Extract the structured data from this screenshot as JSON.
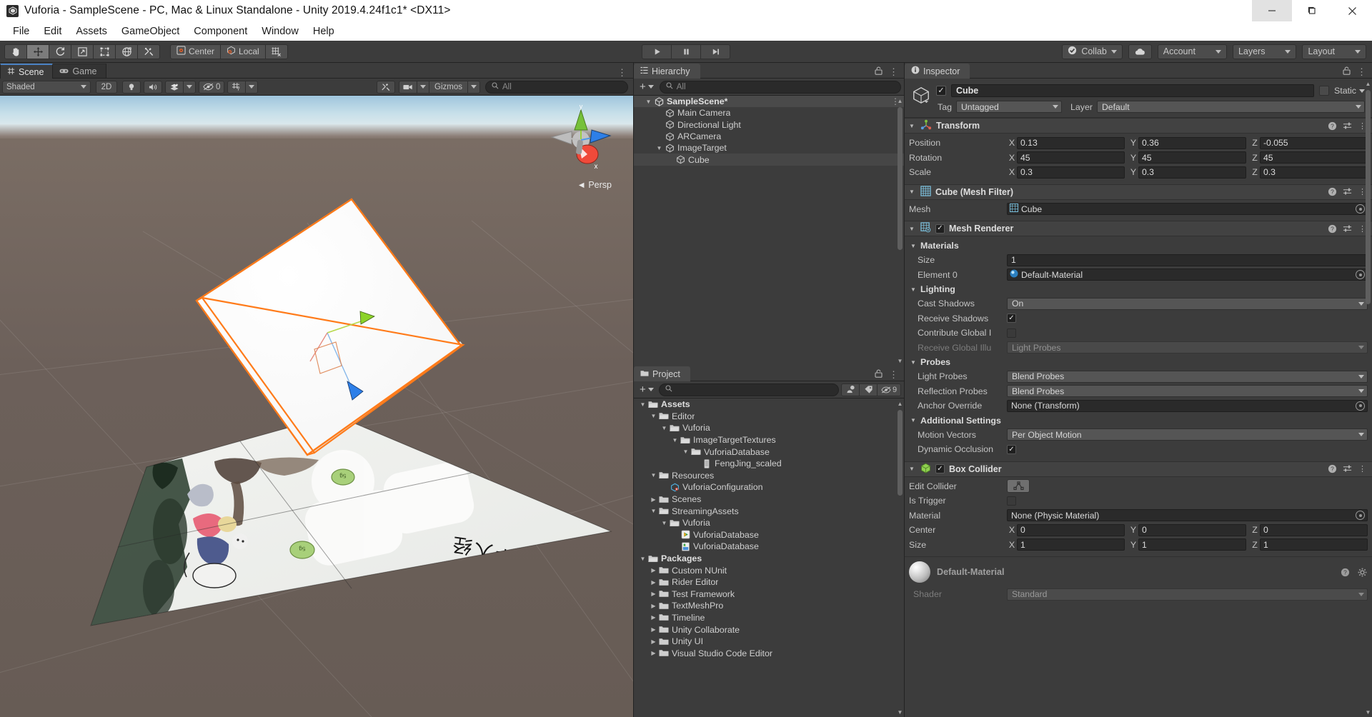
{
  "window": {
    "title": "Vuforia - SampleScene - PC, Mac & Linux Standalone - Unity 2019.4.24f1c1* <DX11>",
    "minimize": "minimize-button",
    "maximize": "maximize-button",
    "close": "close-button"
  },
  "menubar": {
    "items": [
      "File",
      "Edit",
      "Assets",
      "GameObject",
      "Component",
      "Window",
      "Help"
    ]
  },
  "toolbar": {
    "tools": [
      {
        "name": "hand-tool",
        "icon": "hand",
        "active": false
      },
      {
        "name": "move-tool",
        "icon": "move",
        "active": true
      },
      {
        "name": "rotate-tool",
        "icon": "rotate",
        "active": false
      },
      {
        "name": "scale-tool",
        "icon": "scale",
        "active": false
      },
      {
        "name": "rect-tool",
        "icon": "rect",
        "active": false
      },
      {
        "name": "transform-tool",
        "icon": "transform",
        "active": false
      },
      {
        "name": "custom-editor-tool",
        "icon": "wrench",
        "active": false
      }
    ],
    "pivot_label": "Center",
    "space_label": "Local",
    "snap_label": "grid-snap",
    "play": "play-button",
    "pause": "pause-button",
    "step": "step-button",
    "collab_label": "Collab",
    "cloud_label": "cloud-button",
    "account_label": "Account",
    "layers_label": "Layers",
    "layout_label": "Layout"
  },
  "scene_panel": {
    "tabs": [
      {
        "label": "Scene",
        "active": true
      },
      {
        "label": "Game",
        "active": false
      }
    ],
    "shading_mode": "Shaded",
    "two_d_label": "2D",
    "lighting_toggle": "lighting-icon",
    "audio_toggle": "audio-icon",
    "fx_toggle": "fx-icon",
    "hidden_count": "0",
    "grid_label": "grid-icon",
    "tool_settings": "scene-tools-icon",
    "camera_label": "camera-icon",
    "gizmos_label": "Gizmos",
    "search_placeholder": "All",
    "gizmo": {
      "axis_y": "y",
      "axis_x": "x",
      "mode_label": "Persp"
    }
  },
  "hierarchy": {
    "tab_label": "Hierarchy",
    "create_label": "+",
    "search_placeholder": "All",
    "items": [
      {
        "label": "SampleScene*",
        "depth": 0,
        "twist": "down",
        "icon": "scene-icon",
        "bold": true,
        "selected": true,
        "dots": true
      },
      {
        "label": "Main Camera",
        "depth": 1,
        "twist": "",
        "icon": "gameobject-icon",
        "bold": false,
        "selected": false,
        "dots": false
      },
      {
        "label": "Directional Light",
        "depth": 1,
        "twist": "",
        "icon": "gameobject-icon",
        "bold": false,
        "selected": false,
        "dots": false
      },
      {
        "label": "ARCamera",
        "depth": 1,
        "twist": "",
        "icon": "gameobject-icon",
        "bold": false,
        "selected": false,
        "dots": false
      },
      {
        "label": "ImageTarget",
        "depth": 1,
        "twist": "down",
        "icon": "gameobject-icon",
        "bold": false,
        "selected": false,
        "dots": false
      },
      {
        "label": "Cube",
        "depth": 2,
        "twist": "",
        "icon": "gameobject-icon",
        "bold": false,
        "selected": true,
        "dots": false
      }
    ]
  },
  "project": {
    "tab_label": "Project",
    "create_label": "+",
    "search_placeholder": "",
    "visibility_count": "9",
    "items": [
      {
        "label": "Assets",
        "depth": 0,
        "twist": "down",
        "icon": "folder-open",
        "bold": true
      },
      {
        "label": "Editor",
        "depth": 1,
        "twist": "down",
        "icon": "folder-open",
        "bold": false
      },
      {
        "label": "Vuforia",
        "depth": 2,
        "twist": "down",
        "icon": "folder-open",
        "bold": false
      },
      {
        "label": "ImageTargetTextures",
        "depth": 3,
        "twist": "down",
        "icon": "folder-open",
        "bold": false
      },
      {
        "label": "VuforiaDatabase",
        "depth": 4,
        "twist": "down",
        "icon": "folder-open",
        "bold": false
      },
      {
        "label": "FengJing_scaled",
        "depth": 5,
        "twist": "",
        "icon": "texture-icon",
        "bold": false
      },
      {
        "label": "Resources",
        "depth": 1,
        "twist": "down",
        "icon": "folder-open",
        "bold": false
      },
      {
        "label": "VuforiaConfiguration",
        "depth": 2,
        "twist": "",
        "icon": "config-icon",
        "bold": false
      },
      {
        "label": "Scenes",
        "depth": 1,
        "twist": "right",
        "icon": "folder-closed",
        "bold": false
      },
      {
        "label": "StreamingAssets",
        "depth": 1,
        "twist": "down",
        "icon": "folder-open",
        "bold": false
      },
      {
        "label": "Vuforia",
        "depth": 2,
        "twist": "down",
        "icon": "folder-open",
        "bold": false
      },
      {
        "label": "VuforiaDatabase",
        "depth": 3,
        "twist": "",
        "icon": "dat-icon",
        "bold": false
      },
      {
        "label": "VuforiaDatabase",
        "depth": 3,
        "twist": "",
        "icon": "xml-icon",
        "bold": false
      },
      {
        "label": "Packages",
        "depth": 0,
        "twist": "down",
        "icon": "folder-open",
        "bold": true
      },
      {
        "label": "Custom NUnit",
        "depth": 1,
        "twist": "right",
        "icon": "folder-closed",
        "bold": false
      },
      {
        "label": "Rider Editor",
        "depth": 1,
        "twist": "right",
        "icon": "folder-closed",
        "bold": false
      },
      {
        "label": "Test Framework",
        "depth": 1,
        "twist": "right",
        "icon": "folder-closed",
        "bold": false
      },
      {
        "label": "TextMeshPro",
        "depth": 1,
        "twist": "right",
        "icon": "folder-closed",
        "bold": false
      },
      {
        "label": "Timeline",
        "depth": 1,
        "twist": "right",
        "icon": "folder-closed",
        "bold": false
      },
      {
        "label": "Unity Collaborate",
        "depth": 1,
        "twist": "right",
        "icon": "folder-closed",
        "bold": false
      },
      {
        "label": "Unity UI",
        "depth": 1,
        "twist": "right",
        "icon": "folder-closed",
        "bold": false
      },
      {
        "label": "Visual Studio Code Editor",
        "depth": 1,
        "twist": "right",
        "icon": "folder-closed",
        "bold": false
      }
    ]
  },
  "inspector": {
    "tab_label": "Inspector",
    "object_name": "Cube",
    "enabled": true,
    "static_label": "Static",
    "tag_label": "Tag",
    "tag_value": "Untagged",
    "layer_label": "Layer",
    "layer_value": "Default",
    "transform": {
      "title": "Transform",
      "rows": [
        {
          "label": "Position",
          "x": "0.13",
          "y": "0.36",
          "z": "-0.055"
        },
        {
          "label": "Rotation",
          "x": "45",
          "y": "45",
          "z": "45"
        },
        {
          "label": "Scale",
          "x": "0.3",
          "y": "0.3",
          "z": "0.3"
        }
      ]
    },
    "mesh_filter": {
      "title": "Cube (Mesh Filter)",
      "mesh_label": "Mesh",
      "mesh_value": "Cube"
    },
    "mesh_renderer": {
      "title": "Mesh Renderer",
      "enabled": true,
      "materials_label": "Materials",
      "size_label": "Size",
      "size_value": "1",
      "element0_label": "Element 0",
      "element0_value": "Default-Material",
      "lighting_label": "Lighting",
      "cast_shadows_label": "Cast Shadows",
      "cast_shadows_value": "On",
      "receive_shadows_label": "Receive Shadows",
      "receive_shadows_value": true,
      "contribute_gi_label": "Contribute Global I",
      "contribute_gi_value": false,
      "receive_gi_label": "Receive Global Illu",
      "receive_gi_value": "Light Probes",
      "probes_label": "Probes",
      "light_probes_label": "Light Probes",
      "light_probes_value": "Blend Probes",
      "reflection_probes_label": "Reflection Probes",
      "reflection_probes_value": "Blend Probes",
      "anchor_override_label": "Anchor Override",
      "anchor_override_value": "None (Transform)",
      "additional_settings_label": "Additional Settings",
      "motion_vectors_label": "Motion Vectors",
      "motion_vectors_value": "Per Object Motion",
      "dynamic_occlusion_label": "Dynamic Occlusion",
      "dynamic_occlusion_value": true
    },
    "box_collider": {
      "title": "Box Collider",
      "enabled": true,
      "edit_collider_label": "Edit Collider",
      "is_trigger_label": "Is Trigger",
      "is_trigger_value": false,
      "material_label": "Material",
      "material_value": "None (Physic Material)",
      "center_label": "Center",
      "center": {
        "x": "0",
        "y": "0",
        "z": "0"
      },
      "size_label": "Size",
      "size": {
        "x": "1",
        "y": "1",
        "z": "1"
      }
    },
    "material_preview": {
      "title": "Default-Material",
      "shader_label": "Shader",
      "shader_value": "Standard"
    }
  },
  "colors": {
    "accent_blue": "#4a82c4",
    "selection_orange": "#ff7b1a",
    "panel_bg": "#3c3c3c",
    "toolbar_bg": "#3c3c3c",
    "axis_green": "#8cd32a",
    "axis_blue": "#2d7fe8",
    "axis_red": "#f04a3a"
  }
}
